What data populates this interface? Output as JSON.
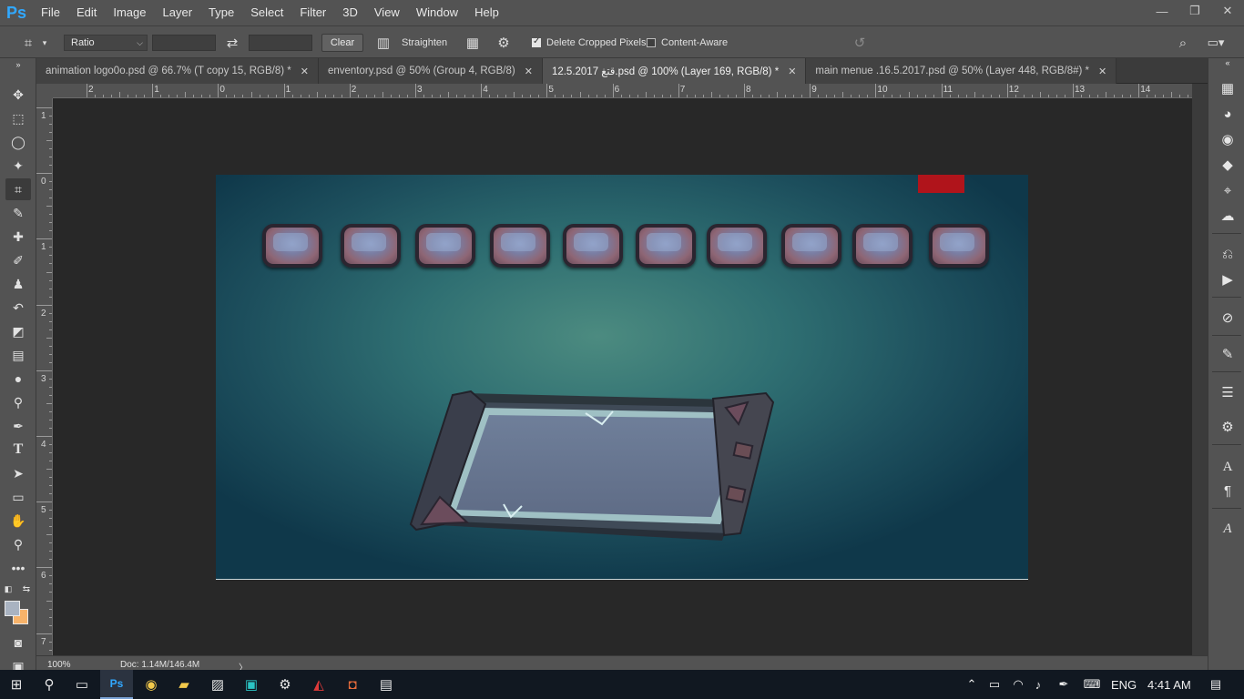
{
  "app": {
    "logo": "Ps"
  },
  "menu": [
    "File",
    "Edit",
    "Image",
    "Layer",
    "Type",
    "Select",
    "Filter",
    "3D",
    "View",
    "Window",
    "Help"
  ],
  "window_controls": {
    "minimize": "—",
    "restore": "❐",
    "close": "✕"
  },
  "options": {
    "ratio_select": "Ratio",
    "clear_label": "Clear",
    "straighten_label": "Straighten",
    "delete_cropped_label": "Delete Cropped Pixels",
    "delete_cropped_checked": true,
    "content_aware_label": "Content-Aware",
    "content_aware_checked": false
  },
  "tabs": [
    {
      "label": "animation logo0o.psd @ 66.7% (T copy 15, RGB/8) *",
      "active": false
    },
    {
      "label": "enventory.psd @ 50% (Group 4, RGB/8)",
      "active": false
    },
    {
      "label": "12.5.2017 قتغ.psd @ 100% (Layer 169, RGB/8) *",
      "active": true
    },
    {
      "label": "main menue .16.5.2017.psd @ 50% (Layer 448, RGB/8#) *",
      "active": false
    }
  ],
  "ruler_top": [
    "2",
    "1",
    "0",
    "1",
    "2",
    "3",
    "4",
    "5",
    "6",
    "7",
    "8",
    "9",
    "10",
    "11",
    "12",
    "13",
    "14"
  ],
  "ruler_left": [
    "1",
    "0",
    "1",
    "2",
    "3",
    "4",
    "5",
    "6",
    "7"
  ],
  "status": {
    "zoom": "100%",
    "doc": "Doc: 1.14M/146.4M",
    "arrow": "〉"
  },
  "colors": {
    "foreground": "#a9b3c1",
    "background": "#f7b36a",
    "accent_red": "#b0141b"
  },
  "toolbar_icons": [
    "move-icon",
    "marquee-icon",
    "lasso-icon",
    "magic-wand-icon",
    "crop-icon",
    "eyedropper-icon",
    "healing-brush-icon",
    "brush-icon",
    "clone-stamp-icon",
    "history-brush-icon",
    "eraser-icon",
    "gradient-icon",
    "blur-icon",
    "dodge-icon",
    "pen-icon",
    "type-icon",
    "path-selection-icon",
    "rectangle-shape-icon",
    "hand-icon",
    "zoom-icon",
    "more-tools-icon"
  ],
  "right_panel_icons": [
    "navigator-icon",
    "color-icon",
    "swatches-icon",
    "layers-icon",
    "paths-icon",
    "cc-libraries-icon",
    "history-icon",
    "actions-icon",
    "clone-source-icon",
    "brushes-icon",
    "adjustments-icon",
    "properties-icon",
    "character-icon",
    "paragraph-icon",
    "glyphs-icon"
  ],
  "taskbar": {
    "language": "ENG",
    "time": "4:41 AM"
  }
}
